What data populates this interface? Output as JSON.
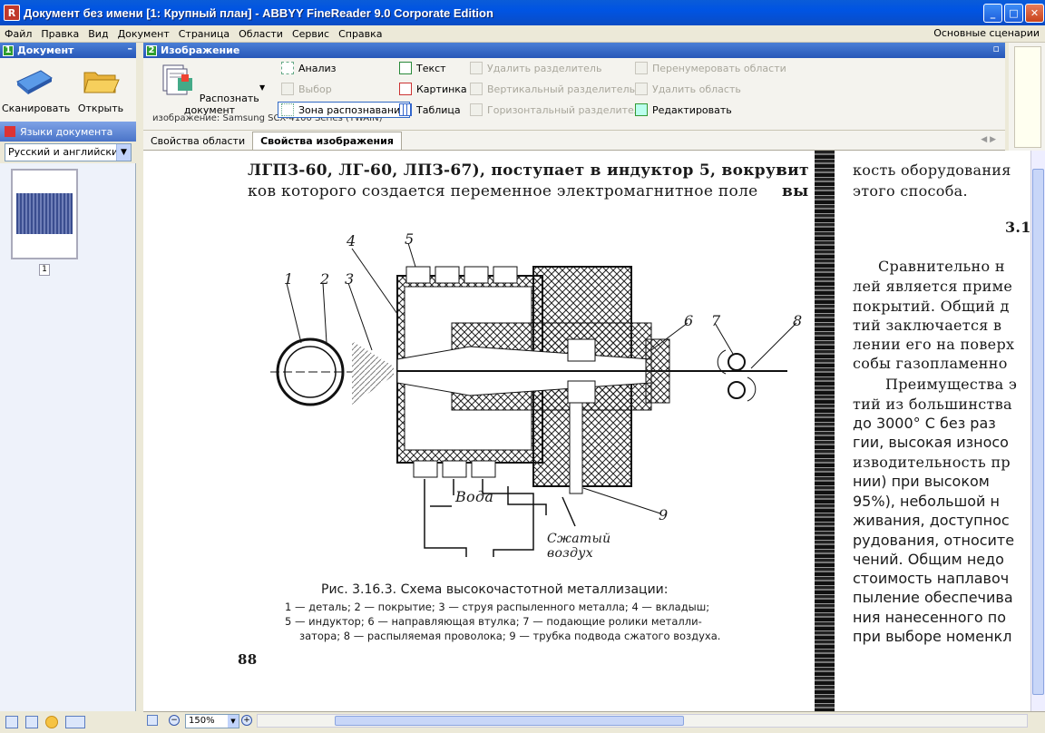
{
  "window": {
    "title": "Документ без имени [1: Крупный план] - ABBYY FineReader 9.0 Corporate Edition",
    "app_icon_letter": "R"
  },
  "menu": {
    "items": [
      "Файл",
      "Правка",
      "Вид",
      "Документ",
      "Страница",
      "Области",
      "Сервис",
      "Справка"
    ],
    "right": "Основные сценарии"
  },
  "document_panel": {
    "badge": "1",
    "title": "Документ",
    "scan_label": "Сканировать",
    "open_label": "Открыть",
    "lang_header": "Языки документа",
    "lang_value": "Русский и английский",
    "page_number": "1"
  },
  "image_panel": {
    "badge": "2",
    "title": "Изображение",
    "recognize_label": "Распознать документ",
    "tools": {
      "analysis": "Анализ",
      "select": "Выбор",
      "zone": "Зона распознавания",
      "text": "Текст",
      "picture": "Картинка",
      "table": "Таблица",
      "del_sep": "Удалить разделитель",
      "vert_sep": "Вертикальный разделитель",
      "horiz_sep": "Горизонтальный разделитель",
      "renumber": "Перенумеровать области",
      "del_area": "Удалить область",
      "edit": "Редактировать"
    },
    "hidden_row": "изображение:          Samsung SCX-4100 Series (TWAIN)",
    "tabs": [
      "Свойства области",
      "Свойства изображения"
    ]
  },
  "scan": {
    "top_line1": "ЛГПЗ-60, ЛГ-60, ЛПЗ-67), поступает в индуктор 5, вокруг",
    "top_line1_tail": "вит",
    "top_line2": "ков которого создается переменное электромагнитное поле",
    "top_line2_tail": "вы",
    "labels": [
      "1",
      "2",
      "3",
      "4",
      "5",
      "6",
      "7",
      "8",
      "9"
    ],
    "water": "Вода",
    "air1": "Сжатый",
    "air2": "воздух",
    "caption": "Рис. 3.16.3. Схема высокочастотной металлизации:",
    "legend1": "1 — деталь;  2 — покрытие;  3 — струя распыленного металла;  4 — вкладыш;",
    "legend2": "5 — индуктор;  6 — направляющая втулка;  7 — подающие ролики металли-",
    "legend3": "затора;  8 — распыляемая проволока;  9 — трубка подвода сжатого воздуха.",
    "page_no": "88",
    "right_col": [
      "кость оборудования",
      "этого способа.",
      "3.1",
      "Сравнительно н",
      "лей является приме",
      "покрытий. Общий д",
      "тий заключается в",
      "лении его на поверх",
      "собы газопламенно",
      "Преимущества э",
      "тий из большинства",
      "до 3000° С без раз",
      "гии, высокая износо",
      "изводительность пр",
      "нии) при высоком",
      "95%),  небольшой н",
      "живания, доступнос",
      "рудования, относите",
      "чений. Общим недо",
      "стоимость наплавоч",
      "пыление обеспечива",
      "ния нанесенного по",
      "при выборе номенкл"
    ]
  },
  "status": {
    "zoom": "150%"
  }
}
